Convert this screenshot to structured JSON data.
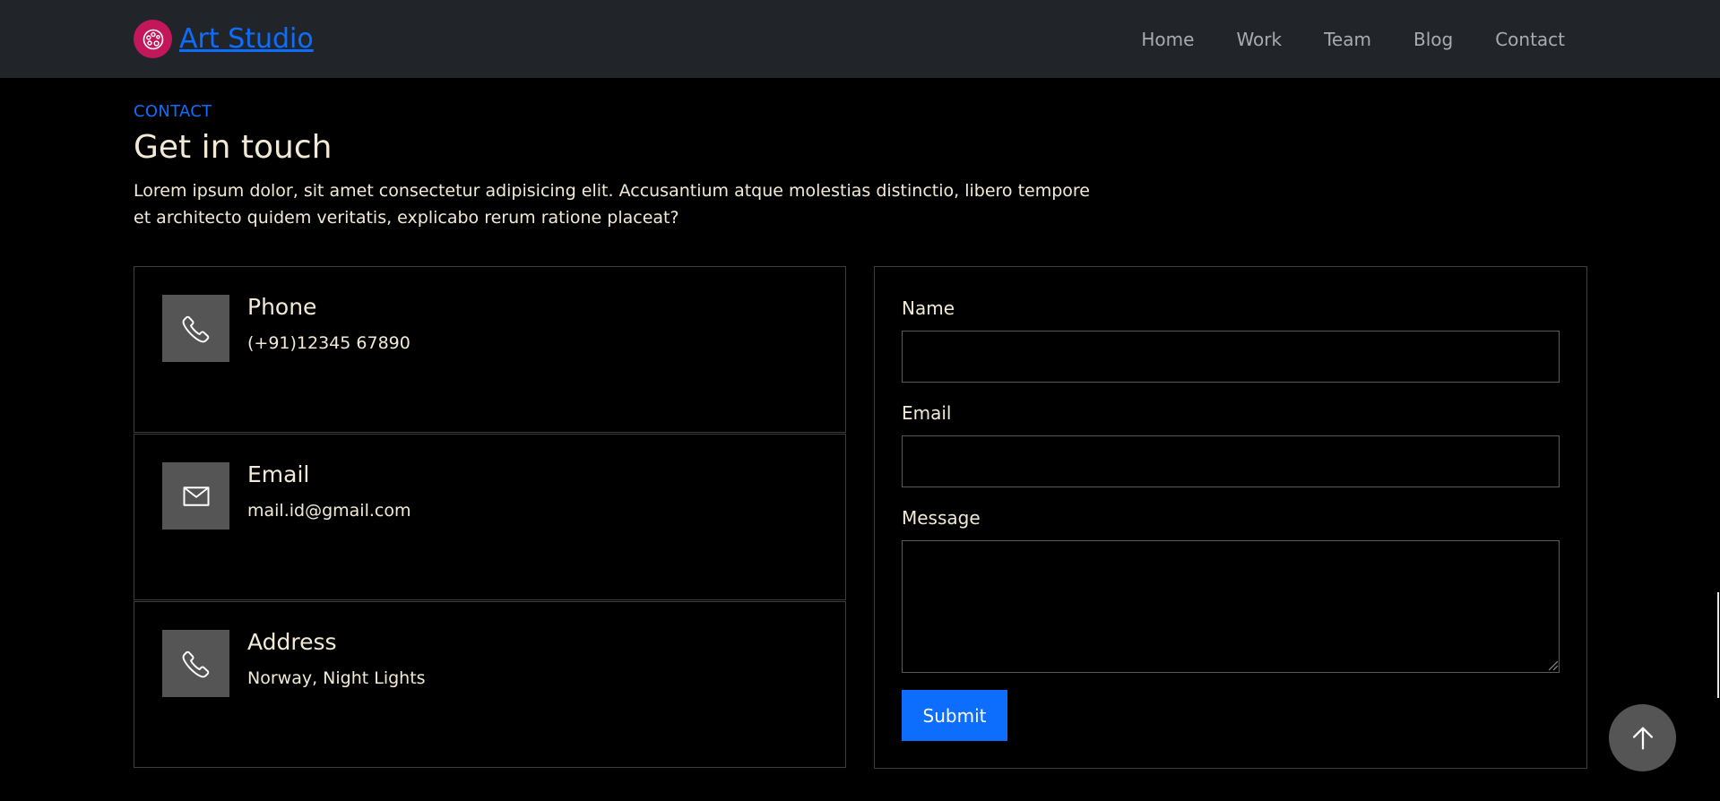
{
  "brand": {
    "name": "Art Studio",
    "logo_icon": "palette-icon",
    "logo_color": "#c2185b",
    "link_color": "#0d6efd"
  },
  "nav": {
    "items": [
      {
        "label": "Home"
      },
      {
        "label": "Work"
      },
      {
        "label": "Team"
      },
      {
        "label": "Blog"
      },
      {
        "label": "Contact"
      }
    ]
  },
  "contact_section": {
    "tag": "CONTACT",
    "title": "Get in touch",
    "description": "Lorem ipsum dolor, sit amet consectetur adipisicing elit. Accusantium atque molestias distinctio, libero tempore et architecto quidem veritatis, explicabo rerum ratione placeat?"
  },
  "info_cards": [
    {
      "title": "Phone",
      "value": "(+91)12345 67890",
      "icon": "phone-icon"
    },
    {
      "title": "Email",
      "value": "mail.id@gmail.com",
      "icon": "envelope-icon"
    },
    {
      "title": "Address",
      "value": "Norway, Night Lights",
      "icon": "phone-icon"
    }
  ],
  "form": {
    "name_label": "Name",
    "name_value": "",
    "email_label": "Email",
    "email_value": "",
    "message_label": "Message",
    "message_value": "",
    "submit_label": "Submit"
  },
  "scroll_top": {
    "icon": "arrow-up-icon"
  },
  "colors": {
    "accent": "#0d6efd",
    "navbar_bg": "#212529",
    "page_bg": "#000000",
    "text": "#f2ead7",
    "icon_box_bg": "#555555"
  }
}
